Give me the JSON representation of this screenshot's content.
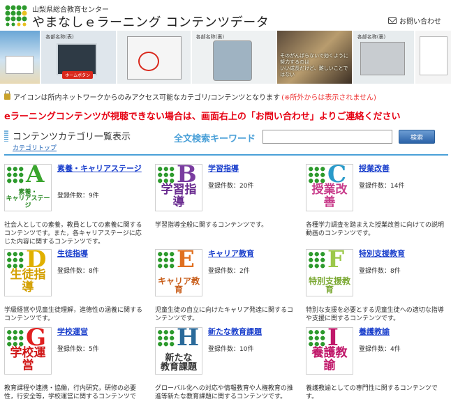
{
  "header": {
    "org_name": "山梨県総合教育センター",
    "site_title": "やまなしｅラーニング コンテンツデータ",
    "contact_label": "お問い合わせ",
    "logo_icon": "dot-cluster-logo",
    "mail_icon": "mail-icon"
  },
  "banner": {
    "panel_labels": [
      "各部名称(表)",
      "各部名称(裏)",
      "各部名称(裏)"
    ],
    "small_button": "ホームボタン",
    "caption_line1": "そのがんばらないで効くように努力するのは",
    "caption_line2": "いい成長だけど、難しいことではない"
  },
  "notice": {
    "text": "アイコンは所内ネットワークからのみアクセス可能なカテゴリ/コンテンツとなります",
    "red_text": "(※所外からは表示されません)",
    "lock_color": "#c9a22c"
  },
  "alert": "eラーニングコンテンツが視聴できない場合は、画面右上の「お問い合わせ」よりご連絡ください",
  "category_header": {
    "title": "コンテンツカテゴリ一覧表示",
    "top_link": "カテゴリトップ",
    "search_label": "全文検索キーワード",
    "search_value": "",
    "search_button": "検索"
  },
  "colors": {
    "accent_blue": "#4aa0d8",
    "alert_red": "#e60012",
    "link_blue": "#1a3fcc",
    "dot_green": "#2d9a2d"
  },
  "categories": [
    {
      "letter": "A",
      "word": "素養・\nキャリアステージ",
      "title": "素養・キャリアステージ",
      "count": "登録件数：9件",
      "desc": "社会人としての素養，教員としての素養に関するコンテンツです。また，各キャリアステージに応じた内容に関するコンテンツです。",
      "letter_color": "#3aa52e",
      "word_color": "#2a8a24"
    },
    {
      "letter": "B",
      "word": "学習指導",
      "title": "学習指導",
      "count": "登録件数：20件",
      "desc": "学習指導全般に関するコンテンツです。",
      "letter_color": "#7a3da0",
      "word_color": "#6a2c90"
    },
    {
      "letter": "C",
      "word": "授業改善",
      "title": "授業改善",
      "count": "登録件数：14件",
      "desc": "各種学力調査を踏まえた授業改善に向けての説明動画のコンテンツです。",
      "letter_color": "#2a9ac9",
      "word_color": "#c83a8a"
    },
    {
      "letter": "D",
      "word": "生徒指導",
      "title": "生徒指導",
      "count": "登録件数：8件",
      "desc": "学級経営や児童生徒理解，進徳性の涵養に関するコンテンツです。",
      "letter_color": "#e0b000",
      "word_color": "#d4a000"
    },
    {
      "letter": "E",
      "word": "キャリア教育",
      "title": "キャリア教育",
      "count": "登録件数：2件",
      "desc": "児童生徒の自立に向けたキャリア発達に関するコンテンツです。",
      "letter_color": "#e07020",
      "word_color": "#c85c18"
    },
    {
      "letter": "F",
      "word": "特別支援教育",
      "title": "特別支援教育",
      "count": "登録件数：8件",
      "desc": "特別な支援を必要とする児童生徒への適切な指導や支援に関するコンテンツです。",
      "letter_color": "#9cc84a",
      "word_color": "#7aa832"
    },
    {
      "letter": "G",
      "word": "学校運営",
      "title": "学校運営",
      "count": "登録件数：5件",
      "desc": "教育課程や連携・協働，行内研究，研修の必要性，行安全等，学校運営に関するコンテンツです。",
      "letter_color": "#e02020",
      "word_color": "#d01818"
    },
    {
      "letter": "H",
      "word": "新たな\n教育課題",
      "title": "新たな教育課題",
      "count": "登録件数：10件",
      "desc": "グローバル化への対応や情報教育や人権教育の推進等新たな教育課題に関するコンテンツです。",
      "letter_color": "#2a6a9a",
      "word_color": "#333333"
    },
    {
      "letter": "I",
      "word": "養護教諭",
      "title": "養護教諭",
      "count": "登録件数：4件",
      "desc": "養護教諭としての専門性に関するコンテンツです。",
      "letter_color": "#c0186a",
      "word_color": "#c0186a"
    }
  ]
}
